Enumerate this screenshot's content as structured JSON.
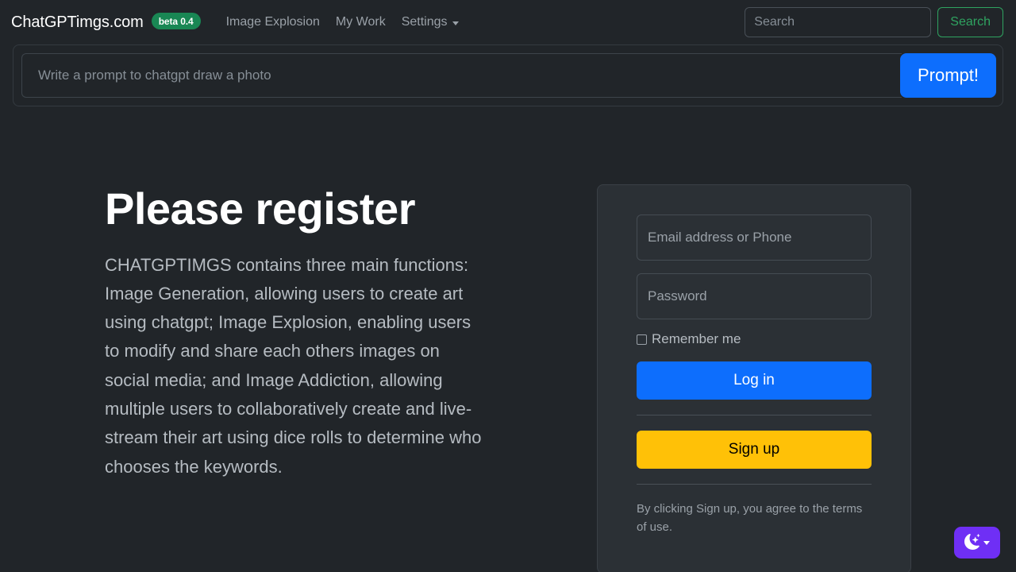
{
  "navbar": {
    "brand": "ChatGPTimgs.com",
    "badge": "beta 0.4",
    "links": [
      {
        "label": "Image Explosion",
        "name": "nav-link-image-explosion"
      },
      {
        "label": "My Work",
        "name": "nav-link-my-work"
      },
      {
        "label": "Settings",
        "name": "nav-link-settings"
      }
    ],
    "search": {
      "placeholder": "Search",
      "value": "",
      "button_label": "Search"
    }
  },
  "prompt_bar": {
    "placeholder": "Write a prompt to chatgpt draw a photo",
    "value": "",
    "button_label": "Prompt!"
  },
  "hero": {
    "heading": "Please register",
    "paragraph": "CHATGPTIMGS contains three main functions: Image Generation, allowing users to create art using chatgpt; Image Explosion, enabling users to modify and share each others images on social media; and Image Addiction, allowing multiple users to collaboratively create and live-stream their art using dice rolls to determine who chooses the keywords."
  },
  "login_card": {
    "email_placeholder": "Email address or Phone",
    "email_value": "",
    "password_placeholder": "Password",
    "password_value": "",
    "remember_label": "Remember me",
    "remember_checked": false,
    "login_label": "Log in",
    "signup_label": "Sign up",
    "terms": "By clicking Sign up, you agree to the terms of use."
  },
  "theme_toggle": {
    "icon": "moon-stars-icon",
    "caret": "chevron-down-icon"
  },
  "colors": {
    "page_background": "#212529",
    "card_background": "#2b3035",
    "accent_blue": "#0d6efd",
    "accent_green": "#198754",
    "search_green": "#2fa360",
    "accent_yellow": "#ffc107",
    "theme_purple": "#6f2ff5"
  }
}
